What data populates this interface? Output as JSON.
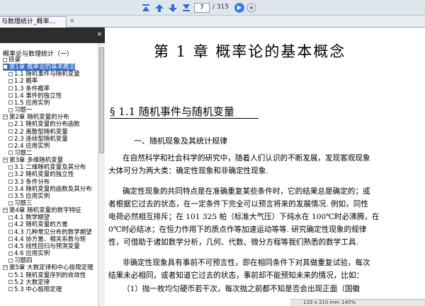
{
  "toolbar": {
    "page_current": "7",
    "page_total": "/ 315"
  },
  "tab": {
    "title": "与数理统计_概率...",
    "close": "×"
  },
  "sidebar": {
    "close": "×",
    "root": "概率论与数理统计（一）",
    "items": [
      {
        "label": "目录"
      },
      {
        "label": "第1章  概率论的基本概念"
      },
      {
        "label": "1.1  随机事件与随机变量"
      },
      {
        "label": "1.2  概率"
      },
      {
        "label": "1.3  条件概率"
      },
      {
        "label": "1.4  事件的独立性"
      },
      {
        "label": "1.5  应用实例"
      },
      {
        "label": "习题一"
      },
      {
        "label": "第2章  随机变量的分布"
      },
      {
        "label": "2.1  随机变量的分布函数"
      },
      {
        "label": "2.2  离散型随机变量"
      },
      {
        "label": "2.3  连续型随机变量"
      },
      {
        "label": "2.4  应用实例"
      },
      {
        "label": "习题二"
      },
      {
        "label": "第3章  多维随机变量"
      },
      {
        "label": "3.1  二维随机变量及其分布"
      },
      {
        "label": "3.2  随机变量的独立性"
      },
      {
        "label": "3.3  条件分布"
      },
      {
        "label": "3.4  随机变量的函数及其分布"
      },
      {
        "label": "3.5  应用实例"
      },
      {
        "label": "习题三"
      },
      {
        "label": "第4章  随机变量的数字特征"
      },
      {
        "label": "4.1  数学期望"
      },
      {
        "label": "4.2  随机变量的方差"
      },
      {
        "label": "4.3  几种常见分布的数学期望"
      },
      {
        "label": "4.4  协方差、相关系数与矩"
      },
      {
        "label": "4.5  线性回归与预测变量"
      },
      {
        "label": "4.6  应用实例"
      },
      {
        "label": "习题四"
      },
      {
        "label": "第5章  大数定律和中心极限定理"
      },
      {
        "label": "5.1  随机变量序列的收敛性"
      },
      {
        "label": "5.2  大数定律"
      },
      {
        "label": "5.3  中心极限定理"
      }
    ]
  },
  "document": {
    "chapter_title": "第 1 章    概率论的基本概念",
    "section_title": "§ 1.1    随机事件与随机变量",
    "subsection": "一、随机现象及其统计规律",
    "paragraphs": [
      "在自然科学和社会科学的研究中，随着人们认识的不断发展，发现客观现象",
      "大体可分为两大类：确定性现象和非确定性现象.",
      "确定性现象的共同特点是在准确重复某些条件时，它的结果总是确定的；或",
      "者根据它过去的状态，在一定条件下完全可以预言将来的发展情况. 例如，同性",
      "电荷必然相互排斥；在 101 325 帕（标准大气压）下纯水在 100℃时必沸腾，在",
      "0℃时必结冰；在恒力作用下的质点作等加速运动等等. 研究确定性现象的规律",
      "性，可借助于诸如数学分析，几何、代数、微分方程等我们熟悉的数学工具.",
      "非确定性现象具有事前不可预言性，即在相同条件下对其做重复试验，每次",
      "结果未必相同，或者知道它过去的状态，事前却不能预知未来的情况，比如：",
      "（1）抛一枚均匀硬币若干次，每次抛之前都不知是否会出现正面（国徽"
    ]
  },
  "status": {
    "size": "133 x 210 mm",
    "zoom": "145%"
  }
}
